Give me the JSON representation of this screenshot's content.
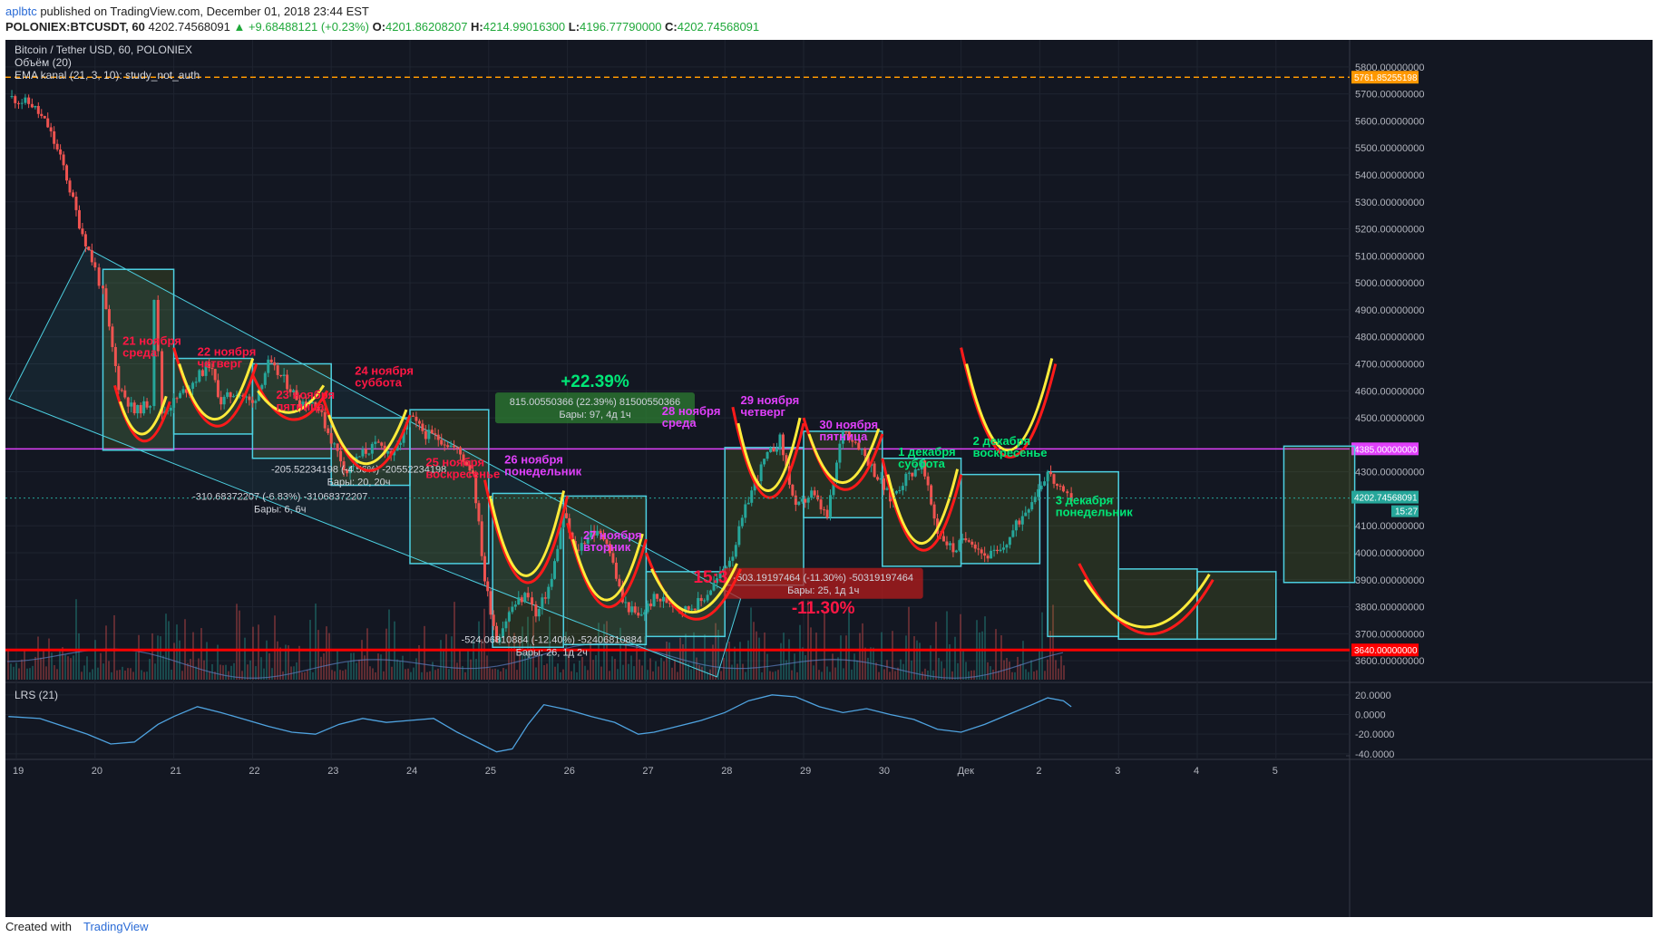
{
  "header": {
    "author": "aplbtc",
    "published_text": "published on TradingView.com, December 01, 2018 23:44 EST",
    "symbol_line": "POLONIEX:BTCUSDT, 60",
    "last": "4202.74568091",
    "change": "▲ +9.68488121 (+0.23%)",
    "o_label": "O:",
    "o": "4201.86208207",
    "h_label": "H:",
    "h": "4214.99016300",
    "l_label": "L:",
    "l": "4196.77790000",
    "c_label": "C:",
    "c": "4202.74568091"
  },
  "legend": {
    "title": "Bitcoin / Tether USD, 60, POLONIEX",
    "volume": "Объём (20)",
    "ema": "EMA kanal (21, 3, 10): study_not_auth",
    "lrs": "LRS (21)"
  },
  "footer": {
    "created": "Created with",
    "brand": "TradingView"
  },
  "colors": {
    "bg": "#131722",
    "up": "#26a69a",
    "down": "#ef5350",
    "red_line": "#ff0000",
    "orange_line": "#ff9800",
    "magenta_line": "#e040fb",
    "yellow": "#ffeb3b",
    "teal_box": "#4dd0e1"
  },
  "chart_data": [
    {
      "type": "candlestick",
      "title": "Bitcoin / Tether USD, 60, POLONIEX",
      "x_ticks": [
        "19",
        "20",
        "21",
        "22",
        "23",
        "24",
        "25",
        "26",
        "27",
        "28",
        "29",
        "30",
        "Дек",
        "2",
        "3",
        "4",
        "5"
      ],
      "y_ticks": [
        "5800.00000000",
        "5700.00000000",
        "5600.00000000",
        "5500.00000000",
        "5400.00000000",
        "5300.00000000",
        "5200.00000000",
        "5100.00000000",
        "5000.00000000",
        "4900.00000000",
        "4800.00000000",
        "4700.00000000",
        "4600.00000000",
        "4500.00000000",
        "4300.00000000",
        "4100.00000000",
        "4000.00000000",
        "3900.00000000",
        "3800.00000000",
        "3700.00000000",
        "3600.00000000"
      ],
      "ylim": [
        3530,
        5880
      ],
      "xlim": [
        18.85,
        5.9
      ],
      "price_close_path": [
        [
          18.9,
          5690
        ],
        [
          19.2,
          5660
        ],
        [
          19.4,
          5580
        ],
        [
          19.6,
          5430
        ],
        [
          19.8,
          5220
        ],
        [
          20.0,
          5050
        ],
        [
          20.1,
          4960
        ],
        [
          20.3,
          4620
        ],
        [
          20.5,
          4520
        ],
        [
          20.7,
          4560
        ],
        [
          20.75,
          4950
        ],
        [
          20.85,
          4520
        ],
        [
          21.0,
          4560
        ],
        [
          21.2,
          4620
        ],
        [
          21.45,
          4700
        ],
        [
          21.6,
          4560
        ],
        [
          21.8,
          4600
        ],
        [
          22.0,
          4550
        ],
        [
          22.2,
          4700
        ],
        [
          22.4,
          4640
        ],
        [
          22.6,
          4560
        ],
        [
          22.8,
          4560
        ],
        [
          23.0,
          4420
        ],
        [
          23.2,
          4300
        ],
        [
          23.4,
          4370
        ],
        [
          23.6,
          4400
        ],
        [
          23.8,
          4360
        ],
        [
          24.0,
          4500
        ],
        [
          24.2,
          4440
        ],
        [
          24.4,
          4420
        ],
        [
          24.6,
          4380
        ],
        [
          24.8,
          4300
        ],
        [
          24.95,
          3900
        ],
        [
          25.1,
          3680
        ],
        [
          25.3,
          3800
        ],
        [
          25.5,
          3850
        ],
        [
          25.6,
          3760
        ],
        [
          25.8,
          3900
        ],
        [
          25.95,
          4150
        ],
        [
          26.1,
          4000
        ],
        [
          26.3,
          4080
        ],
        [
          26.5,
          4050
        ],
        [
          26.7,
          3820
        ],
        [
          26.9,
          3760
        ],
        [
          27.1,
          3830
        ],
        [
          27.3,
          3820
        ],
        [
          27.5,
          3790
        ],
        [
          27.7,
          3820
        ],
        [
          27.9,
          3900
        ],
        [
          28.1,
          4000
        ],
        [
          28.3,
          4200
        ],
        [
          28.5,
          4340
        ],
        [
          28.7,
          4420
        ],
        [
          28.9,
          4160
        ],
        [
          29.1,
          4220
        ],
        [
          29.3,
          4130
        ],
        [
          29.5,
          4460
        ],
        [
          29.7,
          4400
        ],
        [
          29.9,
          4300
        ],
        [
          30.1,
          4200
        ],
        [
          30.3,
          4280
        ],
        [
          30.5,
          4330
        ],
        [
          30.7,
          4080
        ],
        [
          30.9,
          4010
        ],
        [
          31.1,
          4060
        ],
        [
          31.3,
          3990
        ],
        [
          31.5,
          4000
        ],
        [
          31.7,
          4100
        ],
        [
          31.9,
          4200
        ],
        [
          32.1,
          4300
        ],
        [
          32.3,
          4210
        ],
        [
          32.4,
          4202.75
        ]
      ],
      "lines": [
        {
          "name": "",
          "value": 5761.85255198,
          "label": "5761.85255198",
          "color": "#ff9800",
          "style": "dashed"
        },
        {
          "name": "",
          "value": 4385.0,
          "label": "4385.00000000",
          "color": "#e040fb",
          "style": "solid"
        },
        {
          "name": "",
          "value": 3640.0,
          "label": "3640.00000000",
          "color": "#ff0000",
          "style": "solid"
        }
      ],
      "last_price": {
        "value": 4202.74568091,
        "label": "4202.74568091",
        "time_label": "15:27"
      },
      "annotations": {
        "days": [
          {
            "text": "21 ноября\nсреда",
            "color": "#ff1744",
            "x": 20.35,
            "y": 4770
          },
          {
            "text": "22 ноября\nчетверг",
            "color": "#ff1744",
            "x": 21.3,
            "y": 4730
          },
          {
            "text": "23 ноября\nпятница",
            "color": "#ff1744",
            "x": 22.3,
            "y": 4570
          },
          {
            "text": "24 ноября\nсуббота",
            "color": "#ff1744",
            "x": 23.3,
            "y": 4660
          },
          {
            "text": "25 ноября\nвоскресенье",
            "color": "#ff1744",
            "x": 24.2,
            "y": 4320
          },
          {
            "text": "26 ноября\nпонедельник",
            "color": "#e040fb",
            "x": 25.2,
            "y": 4330
          },
          {
            "text": "27 ноября\nвторник",
            "color": "#e040fb",
            "x": 26.2,
            "y": 4050
          },
          {
            "text": "28 ноября\nсреда",
            "color": "#e040fb",
            "x": 27.2,
            "y": 4510
          },
          {
            "text": "29 ноября\nчетверг",
            "color": "#e040fb",
            "x": 28.2,
            "y": 4550
          },
          {
            "text": "30 ноября\nпятница",
            "color": "#e040fb",
            "x": 29.2,
            "y": 4460
          },
          {
            "text": "1 декабря\nсуббота",
            "color": "#00e676",
            "x": 30.2,
            "y": 4360
          },
          {
            "text": "2 декабря\nвоскресенье",
            "color": "#00e676",
            "x": 31.15,
            "y": 4400
          },
          {
            "text": "3 декабря\nпонедельник",
            "color": "#00e676",
            "x": 32.2,
            "y": 4180
          }
        ],
        "measures": [
          {
            "text": "815.00550366 (22.39%) 81500550366",
            "sub": "Бары: 97, 4д 1ч",
            "big": "+22.39%",
            "bigcolor": "#00e676",
            "x": 26.35,
            "y": 4540,
            "boxcolor": "#2e7d32"
          },
          {
            "text": "-205.52234198 (-4.56%) -20552234198",
            "sub": "Бары: 20, 20ч",
            "x": 23.35,
            "y": 4290
          },
          {
            "text": "-310.68372207 (-6.83%) -31068372207",
            "sub": "Бары: 6, 6ч",
            "x": 22.35,
            "y": 4190
          },
          {
            "text": "-524.06810884 (-12.40%) -52406810884",
            "sub": "Бары: 26, 1д 2ч",
            "x": 25.8,
            "y": 3660
          },
          {
            "text": "-503.19197464 (-11.30%) -50319197464",
            "sub": "Бары: 25, 1д 1ч",
            "big": "-11.30%",
            "bigcolor": "#ff1744",
            "x": 29.25,
            "y": 3890,
            "boxcolor": "#b71c1c"
          }
        ],
        "partial_label": {
          "text": "15:3",
          "color": "#ff1744",
          "x": 27.6,
          "y": 3890
        }
      }
    },
    {
      "type": "bar",
      "title": "Объём (20)",
      "description_only": true
    },
    {
      "type": "line",
      "title": "LRS (21)",
      "y_ticks": [
        "20.0000",
        "0.0000",
        "-20.0000",
        "-40.0000"
      ],
      "ylim": [
        -42,
        30
      ],
      "values": [
        [
          18.9,
          -2
        ],
        [
          19.3,
          -4
        ],
        [
          19.6,
          -12
        ],
        [
          19.9,
          -20
        ],
        [
          20.2,
          -30
        ],
        [
          20.5,
          -28
        ],
        [
          20.8,
          -10
        ],
        [
          21.0,
          -2
        ],
        [
          21.3,
          8
        ],
        [
          21.6,
          2
        ],
        [
          21.9,
          -5
        ],
        [
          22.2,
          -12
        ],
        [
          22.5,
          -18
        ],
        [
          22.8,
          -20
        ],
        [
          23.1,
          -10
        ],
        [
          23.4,
          -4
        ],
        [
          23.7,
          -8
        ],
        [
          24.0,
          -6
        ],
        [
          24.3,
          -4
        ],
        [
          24.6,
          -18
        ],
        [
          24.9,
          -30
        ],
        [
          25.1,
          -38
        ],
        [
          25.3,
          -35
        ],
        [
          25.5,
          -10
        ],
        [
          25.7,
          10
        ],
        [
          26.0,
          5
        ],
        [
          26.3,
          -2
        ],
        [
          26.6,
          -8
        ],
        [
          26.9,
          -20
        ],
        [
          27.1,
          -18
        ],
        [
          27.4,
          -12
        ],
        [
          27.7,
          -6
        ],
        [
          28.0,
          2
        ],
        [
          28.3,
          14
        ],
        [
          28.6,
          20
        ],
        [
          28.9,
          18
        ],
        [
          29.2,
          8
        ],
        [
          29.5,
          2
        ],
        [
          29.8,
          6
        ],
        [
          30.1,
          0
        ],
        [
          30.4,
          -5
        ],
        [
          30.7,
          -15
        ],
        [
          31.0,
          -18
        ],
        [
          31.3,
          -10
        ],
        [
          31.6,
          0
        ],
        [
          31.9,
          10
        ],
        [
          32.1,
          17
        ],
        [
          32.3,
          14
        ],
        [
          32.4,
          8
        ]
      ]
    }
  ]
}
